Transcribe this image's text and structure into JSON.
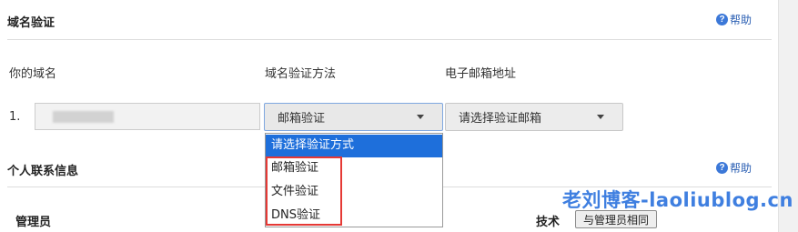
{
  "domain_section": {
    "title": "域名验证",
    "help_label": "帮助"
  },
  "columns": {
    "domain": "你的域名",
    "method": "域名验证方法",
    "email": "电子邮箱地址"
  },
  "row": {
    "number": "1.",
    "method_selected": "邮箱验证",
    "email_placeholder": "请选择验证邮箱"
  },
  "dropdown": {
    "options": [
      "请选择验证方式",
      "邮箱验证",
      "文件验证",
      "DNS验证"
    ],
    "highlighted_index": 0
  },
  "contact_section": {
    "title": "个人联系信息",
    "help_label": "帮助",
    "admin_label": "管理员",
    "tech_label": "技术",
    "same_as_admin_button": "与管理员相同"
  },
  "watermark": "老刘博客-laoliublog.cn",
  "colors": {
    "accent": "#1e6fdb",
    "help_icon": "#3c78d8",
    "highlight_box": "#e53935",
    "watermark": "#3f7fe0"
  }
}
